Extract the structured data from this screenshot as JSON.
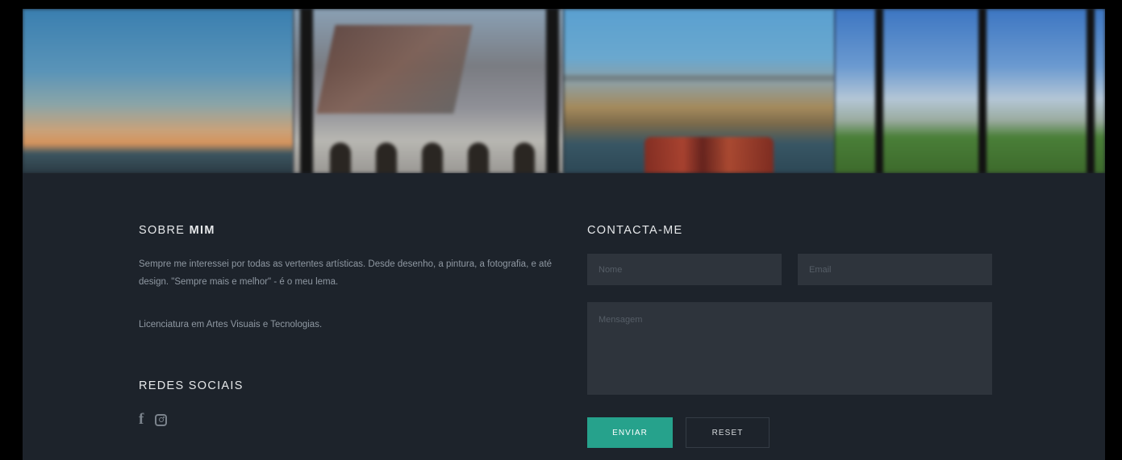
{
  "banner": {
    "photos": [
      {
        "name": "sunset-sea"
      },
      {
        "name": "building-courtyard"
      },
      {
        "name": "river-bridge"
      },
      {
        "name": "window-view"
      }
    ]
  },
  "about": {
    "title_light": "SOBRE",
    "title_bold": "MIM",
    "description": "Sempre me interessei por todas as vertentes artísticas. Desde desenho, a pintura, a fotografia, e até design. \"Sempre mais e melhor\" - é o meu lema.",
    "degree": "Licenciatura em Artes Visuais e Tecnologias."
  },
  "social": {
    "title": "REDES SOCIAIS",
    "icons": [
      "facebook-icon",
      "instagram-icon"
    ]
  },
  "contact": {
    "title": "CONTACTA-ME",
    "name_placeholder": "Nome",
    "email_placeholder": "Email",
    "message_placeholder": "Mensagem",
    "send_label": "ENVIAR",
    "reset_label": "RESET"
  },
  "colors": {
    "background": "#1d232b",
    "accent": "#26a28c",
    "field": "#2e343c"
  }
}
